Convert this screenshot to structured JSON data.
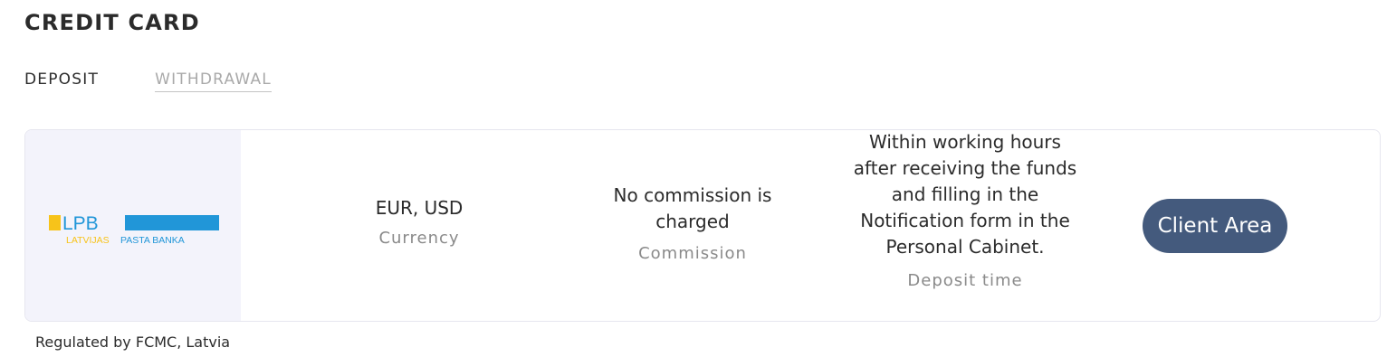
{
  "section_title": "CREDIT CARD",
  "tabs": [
    {
      "label": "DEPOSIT",
      "active": true
    },
    {
      "label": "WITHDRAWAL",
      "active": false
    }
  ],
  "method": {
    "logo": {
      "mark": "LPB",
      "subtitle_left": "LATVIJAS",
      "subtitle_right": "PASTA BANKA",
      "colors": {
        "yellow": "#f7c31a",
        "blue": "#2196d8"
      }
    },
    "currency": {
      "value": "EUR, USD",
      "label": "Currency"
    },
    "commission": {
      "value": "No commission is charged",
      "label": "Commission"
    },
    "deposit_time": {
      "value": "Within working hours after receiving the funds and filling in the Notification form in the Personal Cabinet.",
      "label": "Deposit time"
    },
    "action_label": "Client Area"
  },
  "regulated_text": "Regulated by FCMC, Latvia",
  "colors": {
    "button_bg": "#445a7d",
    "logo_cell_bg": "#f3f3fb"
  }
}
